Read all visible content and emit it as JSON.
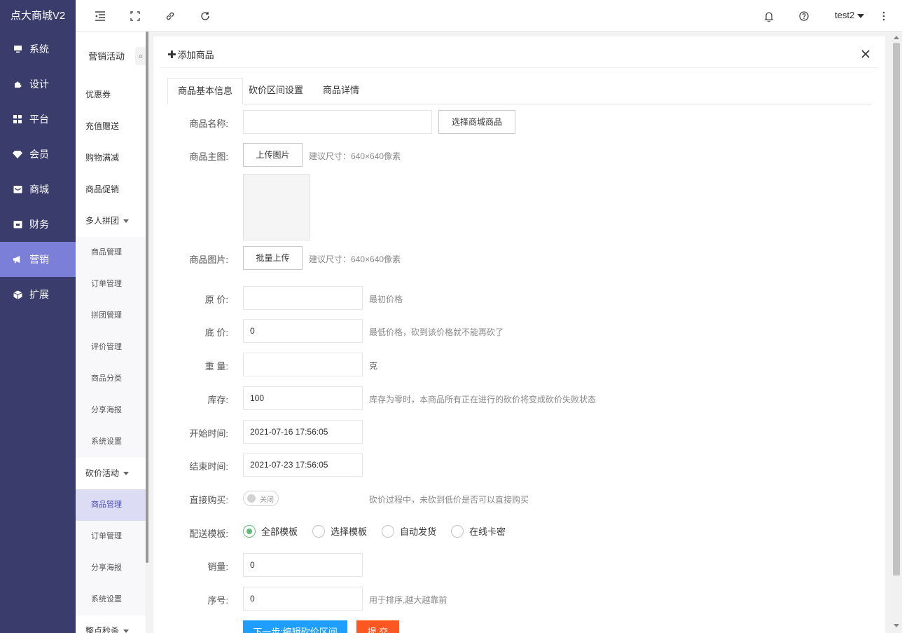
{
  "app": {
    "brand": "点大商城V2"
  },
  "nav": {
    "items": [
      {
        "label": "系统",
        "icon": "monitor-icon"
      },
      {
        "label": "设计",
        "icon": "puzzle-icon"
      },
      {
        "label": "平台",
        "icon": "grid-icon"
      },
      {
        "label": "会员",
        "icon": "diamond-icon"
      },
      {
        "label": "商城",
        "icon": "shop-icon"
      },
      {
        "label": "财务",
        "icon": "wallet-icon"
      },
      {
        "label": "营销",
        "icon": "megaphone-icon"
      },
      {
        "label": "扩展",
        "icon": "cube-icon"
      }
    ],
    "active_index": 6
  },
  "topbar": {
    "user": "test2"
  },
  "subnav": {
    "title": "营销活动",
    "items": [
      {
        "label": "优惠券",
        "kind": "item"
      },
      {
        "label": "充值赠送",
        "kind": "item"
      },
      {
        "label": "购物满减",
        "kind": "item"
      },
      {
        "label": "商品促销",
        "kind": "item"
      },
      {
        "label": "多人拼团",
        "kind": "group"
      },
      {
        "label": "商品管理",
        "kind": "child"
      },
      {
        "label": "订单管理",
        "kind": "child"
      },
      {
        "label": "拼团管理",
        "kind": "child"
      },
      {
        "label": "评价管理",
        "kind": "child"
      },
      {
        "label": "商品分类",
        "kind": "child"
      },
      {
        "label": "分享海报",
        "kind": "child"
      },
      {
        "label": "系统设置",
        "kind": "child"
      },
      {
        "label": "砍价活动",
        "kind": "group"
      },
      {
        "label": "商品管理",
        "kind": "child",
        "active": true
      },
      {
        "label": "订单管理",
        "kind": "child"
      },
      {
        "label": "分享海报",
        "kind": "child"
      },
      {
        "label": "系统设置",
        "kind": "child"
      },
      {
        "label": "整点秒杀",
        "kind": "group"
      }
    ]
  },
  "panel": {
    "title": "添加商品",
    "tabs": [
      "商品基本信息",
      "砍价区间设置",
      "商品详情"
    ],
    "active_tab": 0
  },
  "form": {
    "name_label": "商品名称:",
    "name_value": "",
    "select_goods_btn": "选择商城商品",
    "main_pic_label": "商品主图:",
    "upload_btn": "上传图片",
    "main_pic_hint": "建议尺寸：640×640像素",
    "pics_label": "商品图片:",
    "batch_upload_btn": "批量上传",
    "pics_hint": "建议尺寸：640×640像素",
    "orig_price_label": "原 价:",
    "orig_price_value": "",
    "orig_price_hint": "最初价格",
    "min_price_label": "底 价:",
    "min_price_value": "0",
    "min_price_hint": "最低价格，砍到该价格就不能再砍了",
    "weight_label": "重 量:",
    "weight_value": "",
    "weight_unit": "克",
    "stock_label": "库存:",
    "stock_value": "100",
    "stock_hint": "库存为零时，本商品所有正在进行的砍价将变成砍价失败状态",
    "start_label": "开始时间:",
    "start_value": "2021-07-16 17:56:05",
    "end_label": "结束时间:",
    "end_value": "2021-07-23 17:56:05",
    "direct_buy_label": "直接购买:",
    "direct_buy_switch": "关闭",
    "direct_buy_hint": "砍价过程中，未砍到低价是否可以直接购买",
    "ship_label": "配送模板:",
    "ship_options": [
      "全部模板",
      "选择模板",
      "自动发货",
      "在线卡密"
    ],
    "ship_selected": 0,
    "sales_label": "销量:",
    "sales_value": "0",
    "sort_label": "序号:",
    "sort_value": "0",
    "sort_hint": "用于排序,越大越靠前",
    "next_btn": "下一步:编辑砍价区间",
    "submit_btn": "提 交"
  },
  "colors": {
    "nav_bg": "#3a3d6b",
    "nav_active": "#7b7fd8",
    "radio_on": "#5fb878",
    "next_btn": "#1e9fff",
    "submit_btn": "#ff5722"
  }
}
